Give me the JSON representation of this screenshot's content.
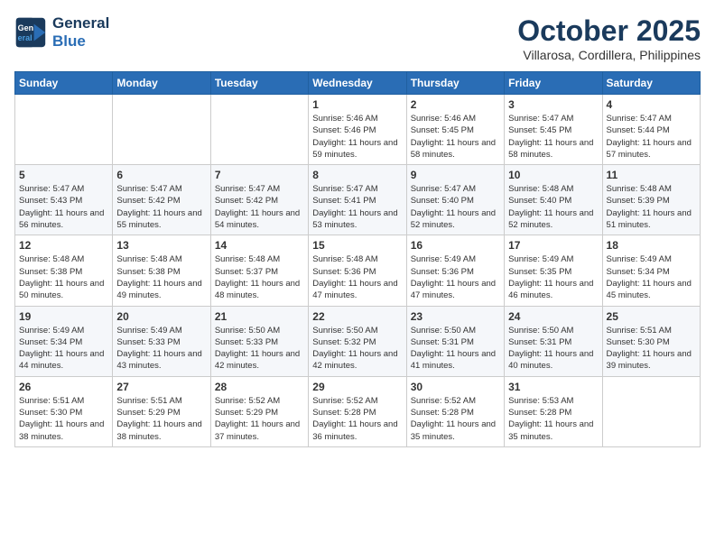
{
  "header": {
    "logo_line1": "General",
    "logo_line2": "Blue",
    "month": "October 2025",
    "location": "Villarosa, Cordillera, Philippines"
  },
  "weekdays": [
    "Sunday",
    "Monday",
    "Tuesday",
    "Wednesday",
    "Thursday",
    "Friday",
    "Saturday"
  ],
  "weeks": [
    [
      {
        "day": "",
        "sunrise": "",
        "sunset": "",
        "daylight": ""
      },
      {
        "day": "",
        "sunrise": "",
        "sunset": "",
        "daylight": ""
      },
      {
        "day": "",
        "sunrise": "",
        "sunset": "",
        "daylight": ""
      },
      {
        "day": "1",
        "sunrise": "Sunrise: 5:46 AM",
        "sunset": "Sunset: 5:46 PM",
        "daylight": "Daylight: 11 hours and 59 minutes."
      },
      {
        "day": "2",
        "sunrise": "Sunrise: 5:46 AM",
        "sunset": "Sunset: 5:45 PM",
        "daylight": "Daylight: 11 hours and 58 minutes."
      },
      {
        "day": "3",
        "sunrise": "Sunrise: 5:47 AM",
        "sunset": "Sunset: 5:45 PM",
        "daylight": "Daylight: 11 hours and 58 minutes."
      },
      {
        "day": "4",
        "sunrise": "Sunrise: 5:47 AM",
        "sunset": "Sunset: 5:44 PM",
        "daylight": "Daylight: 11 hours and 57 minutes."
      }
    ],
    [
      {
        "day": "5",
        "sunrise": "Sunrise: 5:47 AM",
        "sunset": "Sunset: 5:43 PM",
        "daylight": "Daylight: 11 hours and 56 minutes."
      },
      {
        "day": "6",
        "sunrise": "Sunrise: 5:47 AM",
        "sunset": "Sunset: 5:42 PM",
        "daylight": "Daylight: 11 hours and 55 minutes."
      },
      {
        "day": "7",
        "sunrise": "Sunrise: 5:47 AM",
        "sunset": "Sunset: 5:42 PM",
        "daylight": "Daylight: 11 hours and 54 minutes."
      },
      {
        "day": "8",
        "sunrise": "Sunrise: 5:47 AM",
        "sunset": "Sunset: 5:41 PM",
        "daylight": "Daylight: 11 hours and 53 minutes."
      },
      {
        "day": "9",
        "sunrise": "Sunrise: 5:47 AM",
        "sunset": "Sunset: 5:40 PM",
        "daylight": "Daylight: 11 hours and 52 minutes."
      },
      {
        "day": "10",
        "sunrise": "Sunrise: 5:48 AM",
        "sunset": "Sunset: 5:40 PM",
        "daylight": "Daylight: 11 hours and 52 minutes."
      },
      {
        "day": "11",
        "sunrise": "Sunrise: 5:48 AM",
        "sunset": "Sunset: 5:39 PM",
        "daylight": "Daylight: 11 hours and 51 minutes."
      }
    ],
    [
      {
        "day": "12",
        "sunrise": "Sunrise: 5:48 AM",
        "sunset": "Sunset: 5:38 PM",
        "daylight": "Daylight: 11 hours and 50 minutes."
      },
      {
        "day": "13",
        "sunrise": "Sunrise: 5:48 AM",
        "sunset": "Sunset: 5:38 PM",
        "daylight": "Daylight: 11 hours and 49 minutes."
      },
      {
        "day": "14",
        "sunrise": "Sunrise: 5:48 AM",
        "sunset": "Sunset: 5:37 PM",
        "daylight": "Daylight: 11 hours and 48 minutes."
      },
      {
        "day": "15",
        "sunrise": "Sunrise: 5:48 AM",
        "sunset": "Sunset: 5:36 PM",
        "daylight": "Daylight: 11 hours and 47 minutes."
      },
      {
        "day": "16",
        "sunrise": "Sunrise: 5:49 AM",
        "sunset": "Sunset: 5:36 PM",
        "daylight": "Daylight: 11 hours and 47 minutes."
      },
      {
        "day": "17",
        "sunrise": "Sunrise: 5:49 AM",
        "sunset": "Sunset: 5:35 PM",
        "daylight": "Daylight: 11 hours and 46 minutes."
      },
      {
        "day": "18",
        "sunrise": "Sunrise: 5:49 AM",
        "sunset": "Sunset: 5:34 PM",
        "daylight": "Daylight: 11 hours and 45 minutes."
      }
    ],
    [
      {
        "day": "19",
        "sunrise": "Sunrise: 5:49 AM",
        "sunset": "Sunset: 5:34 PM",
        "daylight": "Daylight: 11 hours and 44 minutes."
      },
      {
        "day": "20",
        "sunrise": "Sunrise: 5:49 AM",
        "sunset": "Sunset: 5:33 PM",
        "daylight": "Daylight: 11 hours and 43 minutes."
      },
      {
        "day": "21",
        "sunrise": "Sunrise: 5:50 AM",
        "sunset": "Sunset: 5:33 PM",
        "daylight": "Daylight: 11 hours and 42 minutes."
      },
      {
        "day": "22",
        "sunrise": "Sunrise: 5:50 AM",
        "sunset": "Sunset: 5:32 PM",
        "daylight": "Daylight: 11 hours and 42 minutes."
      },
      {
        "day": "23",
        "sunrise": "Sunrise: 5:50 AM",
        "sunset": "Sunset: 5:31 PM",
        "daylight": "Daylight: 11 hours and 41 minutes."
      },
      {
        "day": "24",
        "sunrise": "Sunrise: 5:50 AM",
        "sunset": "Sunset: 5:31 PM",
        "daylight": "Daylight: 11 hours and 40 minutes."
      },
      {
        "day": "25",
        "sunrise": "Sunrise: 5:51 AM",
        "sunset": "Sunset: 5:30 PM",
        "daylight": "Daylight: 11 hours and 39 minutes."
      }
    ],
    [
      {
        "day": "26",
        "sunrise": "Sunrise: 5:51 AM",
        "sunset": "Sunset: 5:30 PM",
        "daylight": "Daylight: 11 hours and 38 minutes."
      },
      {
        "day": "27",
        "sunrise": "Sunrise: 5:51 AM",
        "sunset": "Sunset: 5:29 PM",
        "daylight": "Daylight: 11 hours and 38 minutes."
      },
      {
        "day": "28",
        "sunrise": "Sunrise: 5:52 AM",
        "sunset": "Sunset: 5:29 PM",
        "daylight": "Daylight: 11 hours and 37 minutes."
      },
      {
        "day": "29",
        "sunrise": "Sunrise: 5:52 AM",
        "sunset": "Sunset: 5:28 PM",
        "daylight": "Daylight: 11 hours and 36 minutes."
      },
      {
        "day": "30",
        "sunrise": "Sunrise: 5:52 AM",
        "sunset": "Sunset: 5:28 PM",
        "daylight": "Daylight: 11 hours and 35 minutes."
      },
      {
        "day": "31",
        "sunrise": "Sunrise: 5:53 AM",
        "sunset": "Sunset: 5:28 PM",
        "daylight": "Daylight: 11 hours and 35 minutes."
      },
      {
        "day": "",
        "sunrise": "",
        "sunset": "",
        "daylight": ""
      }
    ]
  ]
}
